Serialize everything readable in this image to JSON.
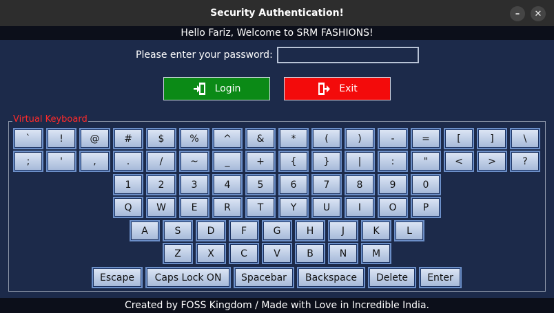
{
  "window": {
    "title": "Security Authentication!",
    "minimize_glyph": "–",
    "close_glyph": "✕"
  },
  "banner": {
    "text": "Hello Fariz, Welcome to SRM FASHIONS!"
  },
  "password": {
    "label": "Please enter your password:",
    "value": ""
  },
  "buttons": {
    "login_label": "Login",
    "login_icon": "door-enter-icon",
    "exit_label": "Exit",
    "exit_icon": "door-exit-icon",
    "login_color": "#0b8a16",
    "exit_color": "#f30b0b"
  },
  "keyboard": {
    "legend": "Virtual Keyboard",
    "rows": [
      [
        "`",
        "!",
        "@",
        "#",
        "$",
        "%",
        "^",
        "&",
        "*",
        "(",
        ")",
        "-",
        "=",
        "[",
        "]",
        "\\"
      ],
      [
        ";",
        "'",
        ",",
        ".",
        "/",
        "~",
        "_",
        "+",
        "{",
        "}",
        "|",
        ":",
        "\"",
        "<",
        ">",
        "?"
      ],
      [
        "1",
        "2",
        "3",
        "4",
        "5",
        "6",
        "7",
        "8",
        "9",
        "0"
      ],
      [
        "Q",
        "W",
        "E",
        "R",
        "T",
        "Y",
        "U",
        "I",
        "O",
        "P"
      ],
      [
        "A",
        "S",
        "D",
        "F",
        "G",
        "H",
        "J",
        "K",
        "L"
      ],
      [
        "Z",
        "X",
        "C",
        "V",
        "B",
        "N",
        "M"
      ],
      [
        "Escape",
        "Caps Lock ON",
        "Spacebar",
        "Backspace",
        "Delete",
        "Enter"
      ]
    ]
  },
  "footer": {
    "text": "Created by FOSS Kingdom / Made with Love in Incredible India."
  }
}
